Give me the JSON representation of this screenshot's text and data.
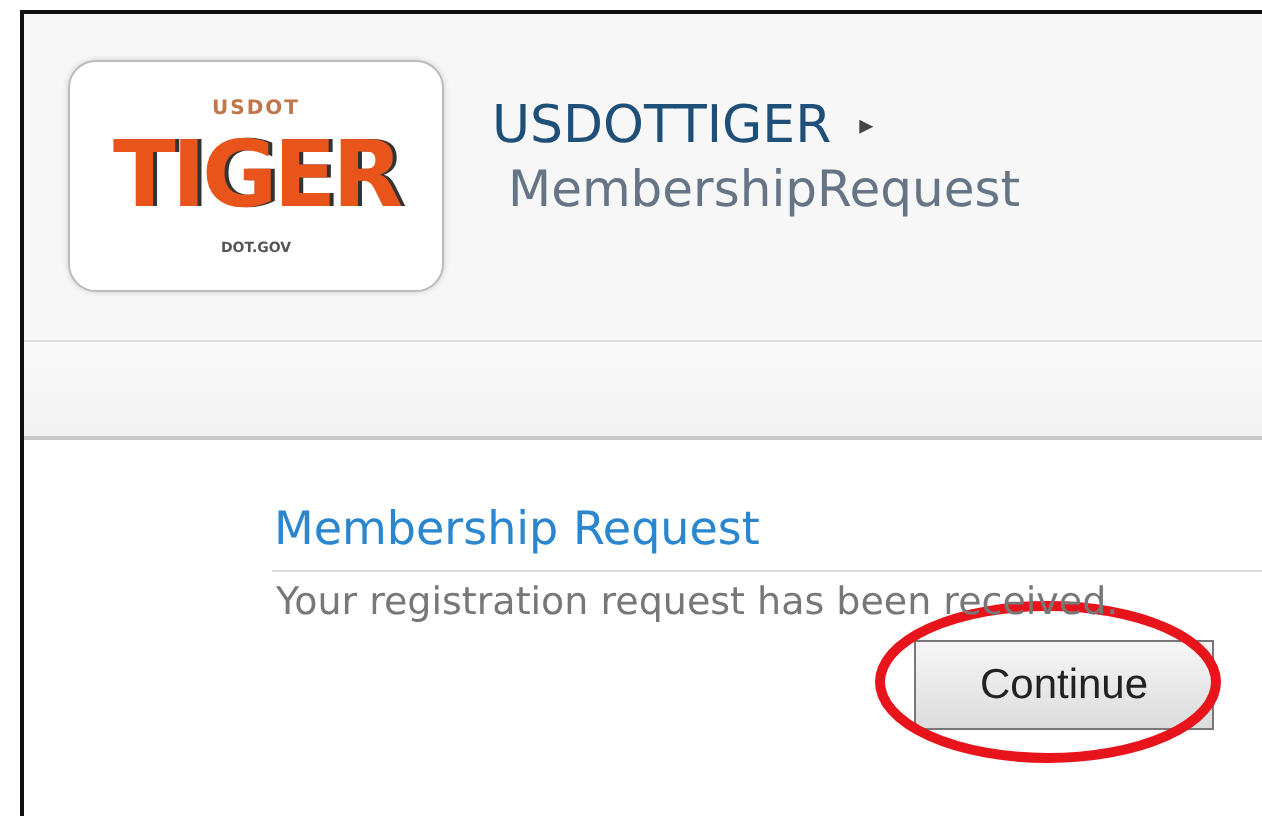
{
  "logo": {
    "top": "USDOT",
    "word": "TIGER",
    "bottom": "DOT.GOV"
  },
  "breadcrumb": {
    "site": "USDOTTIGER",
    "separator": "▸",
    "page": "MembershipRequest"
  },
  "content": {
    "heading": "Membership Request",
    "message": "Your registration request has been received.",
    "button": "Continue"
  },
  "annotation": {
    "kind": "ellipse",
    "color": "#e8141b"
  }
}
